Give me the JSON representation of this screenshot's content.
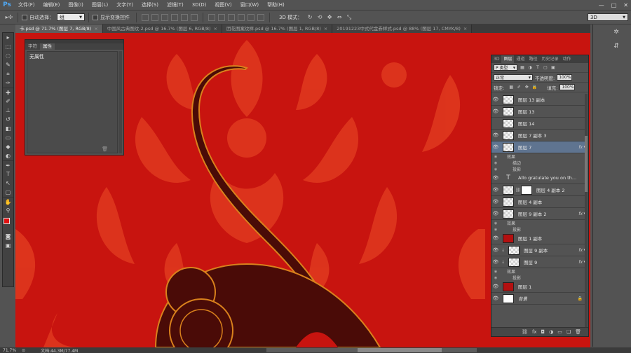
{
  "app": {
    "logo": "Ps"
  },
  "menu": [
    "文件(F)",
    "编辑(E)",
    "图像(I)",
    "图层(L)",
    "文字(Y)",
    "选择(S)",
    "滤镜(T)",
    "3D(D)",
    "视图(V)",
    "窗口(W)",
    "帮助(H)"
  ],
  "window_controls": {
    "minimize": "—",
    "maximize": "□",
    "close": "✕"
  },
  "options": {
    "move_icon": "move-icon",
    "auto_select_label": "自动选择：",
    "auto_select_value": "组",
    "show_transform_label": "显示变换控件",
    "mode3d_label": "3D 模式：",
    "workspace_value": "3D"
  },
  "tabs": [
    {
      "label": "卡.psd @ 71.7% (图层 7, RGB/8)",
      "close": "×",
      "active": true
    },
    {
      "label": "中国风古典图纹-2.psd @ 16.7% (图层 6, RGB/8)",
      "close": "×",
      "active": false
    },
    {
      "label": "团花图案纹样.psd @ 16.7% (图层 1, RGB/8)",
      "close": "×",
      "active": false
    },
    {
      "label": "20191223中式代金券样式.psd @ 88% (图层 17, CMYK/8)",
      "close": "×",
      "active": false
    }
  ],
  "props_panel": {
    "tab_char": "字符",
    "tab_props": "属性",
    "content": "无属性",
    "trash": "🗑"
  },
  "layers_panel": {
    "tabs": [
      "3D",
      "图层",
      "通道",
      "路径",
      "历史记录",
      "动作"
    ],
    "filter_label": "P 类型",
    "blend_mode": "正常",
    "opacity_label": "不透明度:",
    "opacity_value": "100%",
    "lock_label": "锁定:",
    "fill_label": "填充:",
    "fill_value": "100%",
    "layers": [
      {
        "name": "图层 13 副本",
        "thumb": "checker",
        "eye": true,
        "fx": false
      },
      {
        "name": "图层 13",
        "thumb": "checker",
        "eye": true,
        "fx": false
      },
      {
        "name": "图层 14",
        "thumb": "checker",
        "eye": false,
        "fx": false
      },
      {
        "name": "图层 7 副本 3",
        "thumb": "checker",
        "eye": true,
        "fx": false
      },
      {
        "name": "图层 7",
        "thumb": "checker",
        "eye": true,
        "fx": true,
        "selected": true,
        "effects": [
          "效果",
          "描边",
          "投影"
        ]
      },
      {
        "name": "Allo gratulate you on the arri...",
        "thumb": "text",
        "eye": true,
        "fx": false
      },
      {
        "name": "图层 4 副本 2",
        "thumb": "checker",
        "eye": true,
        "fx": false,
        "mask": true
      },
      {
        "name": "图层 4 副本",
        "thumb": "checker",
        "eye": true,
        "fx": false
      },
      {
        "name": "图层 9 副本 2",
        "thumb": "checker",
        "eye": true,
        "fx": true,
        "effects": [
          "效果",
          "投影"
        ]
      },
      {
        "name": "图层 1 副本",
        "thumb": "red",
        "eye": true,
        "fx": false
      },
      {
        "name": "图层 9 副本",
        "thumb": "checker",
        "eye": true,
        "fx": true,
        "clip": true
      },
      {
        "name": "图层 9",
        "thumb": "checker",
        "eye": true,
        "fx": true,
        "clip": true,
        "effects": [
          "效果",
          "投影"
        ]
      },
      {
        "name": "图层 1",
        "thumb": "red",
        "eye": true,
        "fx": false
      },
      {
        "name": "背景",
        "thumb": "white",
        "eye": true,
        "fx": false,
        "locked": true
      }
    ]
  },
  "status": {
    "zoom": "71.7%",
    "doc_info": "文档:44.3M/77.4M"
  },
  "colors": {
    "canvas_bg": "#c8140f",
    "pattern": "#e0391f",
    "rat_body": "#4a0b07",
    "rat_outline": "#d9811c"
  }
}
